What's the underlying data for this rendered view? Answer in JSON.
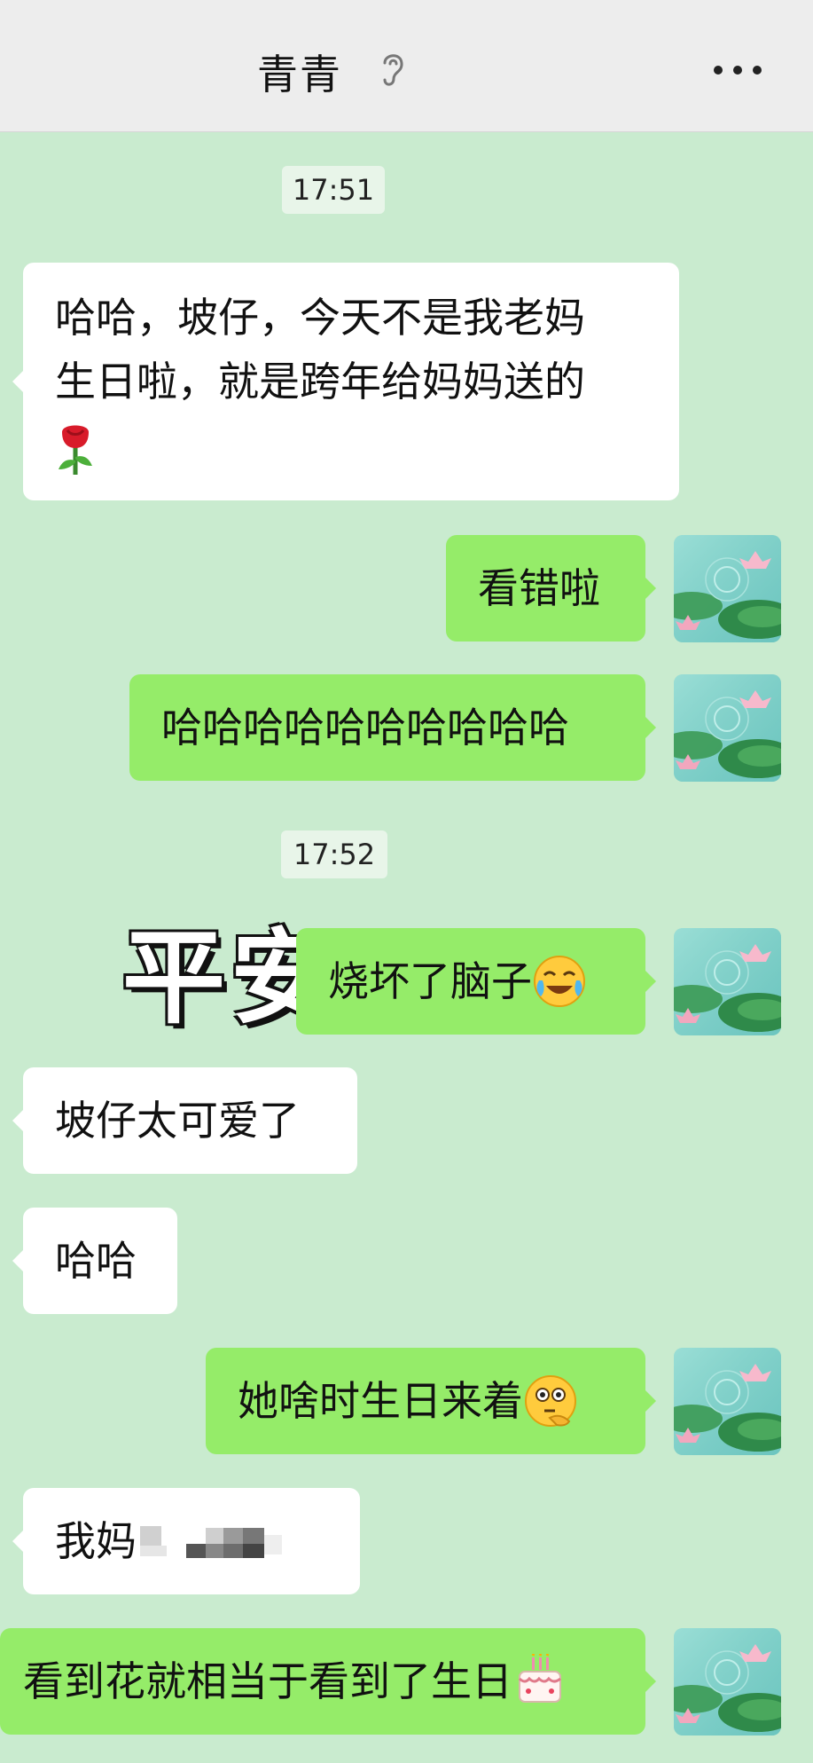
{
  "header": {
    "title": "青青",
    "ear_icon": "ear-icon",
    "more_icon": "more-dots-icon"
  },
  "messages": {
    "time1": "17:51",
    "m1": "哈哈，坡仔，今天不是我老妈生日啦，就是跨年给妈妈送的",
    "m1_line1": "哈哈，坡仔，今天不是我老妈",
    "m1_line2": "生日啦，就是跨年给妈妈送的",
    "m1_emoji": "rose-emoji",
    "m2": "看错啦",
    "m3": "哈哈哈哈哈哈哈哈哈哈",
    "time2": "17:52",
    "sticker_text": "平安",
    "m4": "烧坏了脑子",
    "m4_emoji": "crying-laughing-emoji",
    "m5": "坡仔太可爱了",
    "m6": "哈哈",
    "m7": "她啥时生日来着",
    "m7_emoji": "thinking-face-emoji",
    "m8": "我妈",
    "m8_redacted": "pixelated-redaction",
    "m9": "看到花就相当于看到了生日",
    "m9_emoji": "birthday-cake-emoji"
  },
  "colors": {
    "chat_bg": "#c9ebcf",
    "own_bubble": "#95ec69",
    "other_bubble": "#ffffff",
    "header_bg": "#ededed"
  }
}
